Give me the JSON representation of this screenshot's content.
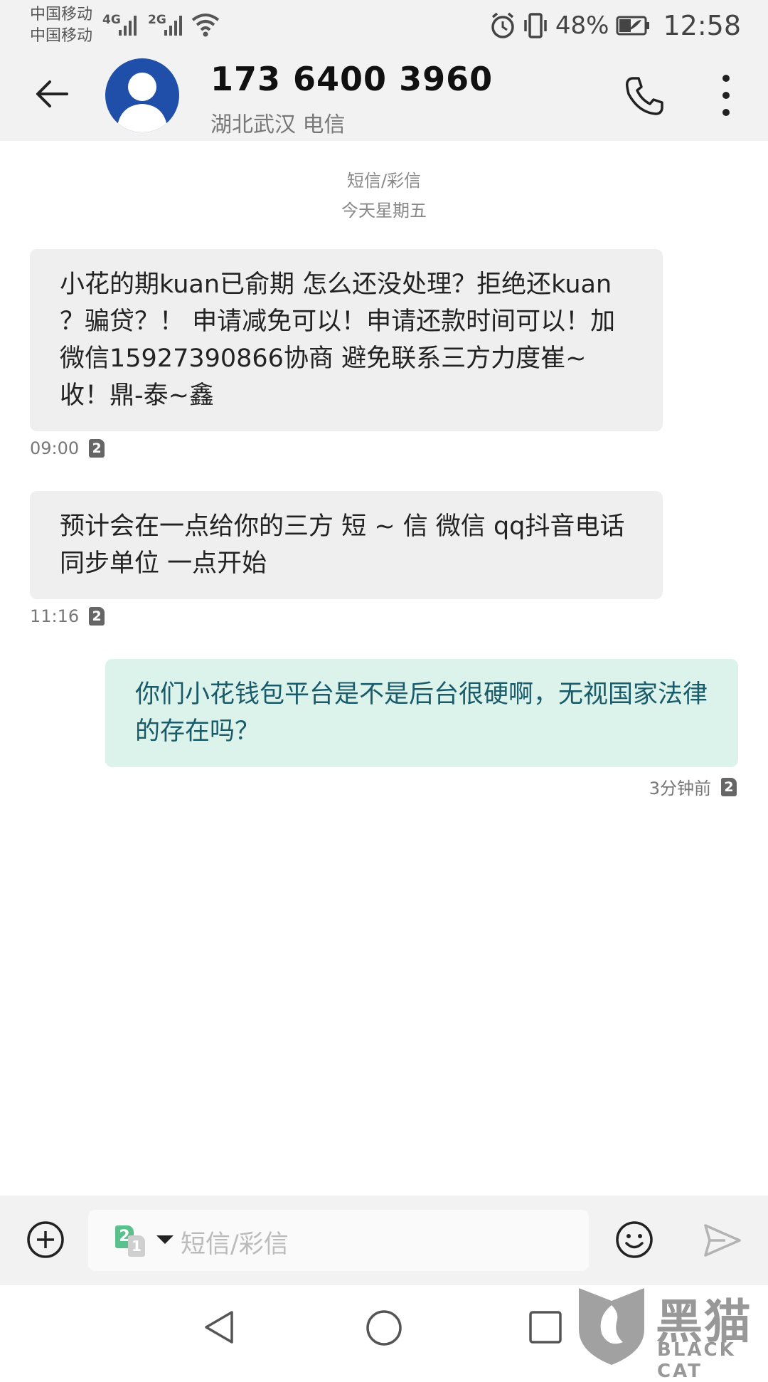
{
  "status_bar": {
    "carrier1": "中国移动",
    "carrier2": "中国移动",
    "net1": "4G",
    "net2": "2G",
    "battery": "48%",
    "battery_level": 0.48,
    "time": "12:58",
    "icons": [
      "signal-icon",
      "wifi-icon",
      "alarm-icon",
      "vibrate-icon",
      "battery-icon"
    ]
  },
  "header": {
    "title": "173 6400 3960",
    "subtitle": "湖北武汉 电信",
    "avatar_color": "#1f4fa8"
  },
  "thread": {
    "channel": "短信/彩信",
    "date": "今天星期五"
  },
  "messages": [
    {
      "direction": "incoming",
      "text": "小花的期kuan已俞期 怎么还没处理？拒绝还kuan ？骗贷？！ 申请减免可以！申请还款时间可以！加微信15927390866协商 避免联系三方力度崔~收！鼎-泰~鑫",
      "time": "09:00",
      "sim": "2"
    },
    {
      "direction": "incoming",
      "text": "预计会在一点给你的三方  短 ~ 信 微信 qq抖音电话同步单位 一点开始",
      "time": "11:16",
      "sim": "2"
    },
    {
      "direction": "outgoing",
      "text": "你们小花钱包平台是不是后台很硬啊，无视国家法律的存在吗？",
      "time": "3分钟前",
      "sim": "2"
    }
  ],
  "composer": {
    "placeholder": "短信/彩信",
    "sim_selected": "2",
    "sim_other": "1"
  },
  "watermark": {
    "cn": "黑猫",
    "en": "BLACK CAT"
  },
  "colors": {
    "incoming_bg": "#efefef",
    "outgoing_bg": "#dcf3ec",
    "outgoing_text": "#1a5b6a",
    "sim_green": "#5cc08d"
  }
}
